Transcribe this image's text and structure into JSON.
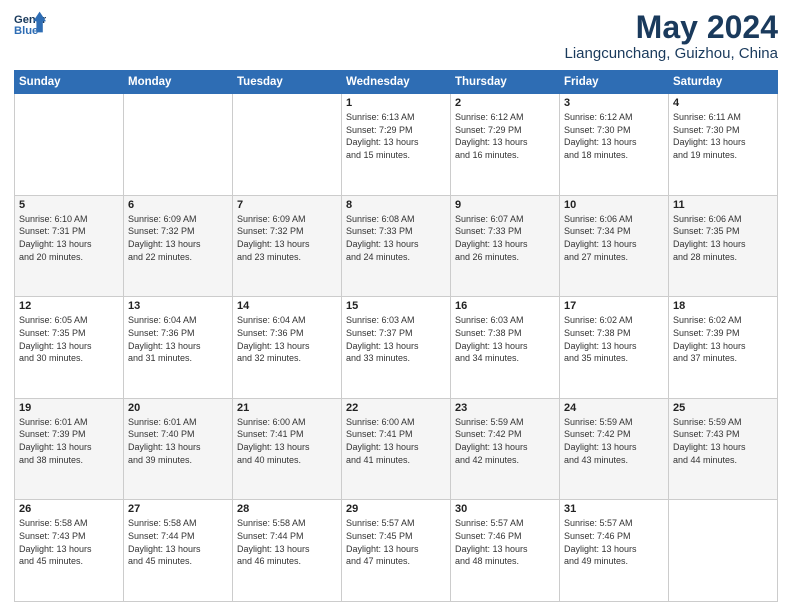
{
  "header": {
    "logo_line1": "General",
    "logo_line2": "Blue",
    "title": "May 2024",
    "subtitle": "Liangcunchang, Guizhou, China"
  },
  "weekdays": [
    "Sunday",
    "Monday",
    "Tuesday",
    "Wednesday",
    "Thursday",
    "Friday",
    "Saturday"
  ],
  "weeks": [
    [
      {
        "day": "",
        "info": ""
      },
      {
        "day": "",
        "info": ""
      },
      {
        "day": "",
        "info": ""
      },
      {
        "day": "1",
        "info": "Sunrise: 6:13 AM\nSunset: 7:29 PM\nDaylight: 13 hours\nand 15 minutes."
      },
      {
        "day": "2",
        "info": "Sunrise: 6:12 AM\nSunset: 7:29 PM\nDaylight: 13 hours\nand 16 minutes."
      },
      {
        "day": "3",
        "info": "Sunrise: 6:12 AM\nSunset: 7:30 PM\nDaylight: 13 hours\nand 18 minutes."
      },
      {
        "day": "4",
        "info": "Sunrise: 6:11 AM\nSunset: 7:30 PM\nDaylight: 13 hours\nand 19 minutes."
      }
    ],
    [
      {
        "day": "5",
        "info": "Sunrise: 6:10 AM\nSunset: 7:31 PM\nDaylight: 13 hours\nand 20 minutes."
      },
      {
        "day": "6",
        "info": "Sunrise: 6:09 AM\nSunset: 7:32 PM\nDaylight: 13 hours\nand 22 minutes."
      },
      {
        "day": "7",
        "info": "Sunrise: 6:09 AM\nSunset: 7:32 PM\nDaylight: 13 hours\nand 23 minutes."
      },
      {
        "day": "8",
        "info": "Sunrise: 6:08 AM\nSunset: 7:33 PM\nDaylight: 13 hours\nand 24 minutes."
      },
      {
        "day": "9",
        "info": "Sunrise: 6:07 AM\nSunset: 7:33 PM\nDaylight: 13 hours\nand 26 minutes."
      },
      {
        "day": "10",
        "info": "Sunrise: 6:06 AM\nSunset: 7:34 PM\nDaylight: 13 hours\nand 27 minutes."
      },
      {
        "day": "11",
        "info": "Sunrise: 6:06 AM\nSunset: 7:35 PM\nDaylight: 13 hours\nand 28 minutes."
      }
    ],
    [
      {
        "day": "12",
        "info": "Sunrise: 6:05 AM\nSunset: 7:35 PM\nDaylight: 13 hours\nand 30 minutes."
      },
      {
        "day": "13",
        "info": "Sunrise: 6:04 AM\nSunset: 7:36 PM\nDaylight: 13 hours\nand 31 minutes."
      },
      {
        "day": "14",
        "info": "Sunrise: 6:04 AM\nSunset: 7:36 PM\nDaylight: 13 hours\nand 32 minutes."
      },
      {
        "day": "15",
        "info": "Sunrise: 6:03 AM\nSunset: 7:37 PM\nDaylight: 13 hours\nand 33 minutes."
      },
      {
        "day": "16",
        "info": "Sunrise: 6:03 AM\nSunset: 7:38 PM\nDaylight: 13 hours\nand 34 minutes."
      },
      {
        "day": "17",
        "info": "Sunrise: 6:02 AM\nSunset: 7:38 PM\nDaylight: 13 hours\nand 35 minutes."
      },
      {
        "day": "18",
        "info": "Sunrise: 6:02 AM\nSunset: 7:39 PM\nDaylight: 13 hours\nand 37 minutes."
      }
    ],
    [
      {
        "day": "19",
        "info": "Sunrise: 6:01 AM\nSunset: 7:39 PM\nDaylight: 13 hours\nand 38 minutes."
      },
      {
        "day": "20",
        "info": "Sunrise: 6:01 AM\nSunset: 7:40 PM\nDaylight: 13 hours\nand 39 minutes."
      },
      {
        "day": "21",
        "info": "Sunrise: 6:00 AM\nSunset: 7:41 PM\nDaylight: 13 hours\nand 40 minutes."
      },
      {
        "day": "22",
        "info": "Sunrise: 6:00 AM\nSunset: 7:41 PM\nDaylight: 13 hours\nand 41 minutes."
      },
      {
        "day": "23",
        "info": "Sunrise: 5:59 AM\nSunset: 7:42 PM\nDaylight: 13 hours\nand 42 minutes."
      },
      {
        "day": "24",
        "info": "Sunrise: 5:59 AM\nSunset: 7:42 PM\nDaylight: 13 hours\nand 43 minutes."
      },
      {
        "day": "25",
        "info": "Sunrise: 5:59 AM\nSunset: 7:43 PM\nDaylight: 13 hours\nand 44 minutes."
      }
    ],
    [
      {
        "day": "26",
        "info": "Sunrise: 5:58 AM\nSunset: 7:43 PM\nDaylight: 13 hours\nand 45 minutes."
      },
      {
        "day": "27",
        "info": "Sunrise: 5:58 AM\nSunset: 7:44 PM\nDaylight: 13 hours\nand 45 minutes."
      },
      {
        "day": "28",
        "info": "Sunrise: 5:58 AM\nSunset: 7:44 PM\nDaylight: 13 hours\nand 46 minutes."
      },
      {
        "day": "29",
        "info": "Sunrise: 5:57 AM\nSunset: 7:45 PM\nDaylight: 13 hours\nand 47 minutes."
      },
      {
        "day": "30",
        "info": "Sunrise: 5:57 AM\nSunset: 7:46 PM\nDaylight: 13 hours\nand 48 minutes."
      },
      {
        "day": "31",
        "info": "Sunrise: 5:57 AM\nSunset: 7:46 PM\nDaylight: 13 hours\nand 49 minutes."
      },
      {
        "day": "",
        "info": ""
      }
    ]
  ]
}
